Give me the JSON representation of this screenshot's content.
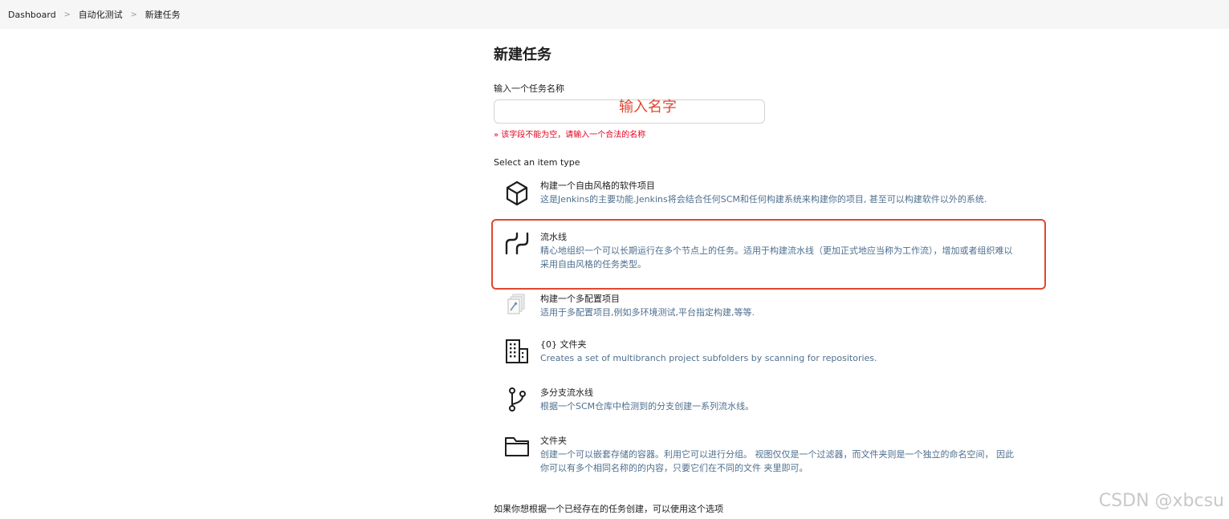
{
  "breadcrumb": {
    "items": [
      "Dashboard",
      "自动化测试",
      "新建任务"
    ],
    "separator": ">"
  },
  "page": {
    "title": "新建任务"
  },
  "name_field": {
    "label": "输入一个任务名称",
    "value": "",
    "annotation": "输入名字",
    "error": "» 该字段不能为空，请输入一个合法的名称"
  },
  "item_type": {
    "label": "Select an item type",
    "items": [
      {
        "icon": "box-icon",
        "name": "构建一个自由风格的软件项目",
        "desc_lines": [
          "这是Jenkins的主要功能.Jenkins将会结合任何SCM和任何构建系统来构建你的项目, 甚至可以构建软件以外的系统."
        ]
      },
      {
        "icon": "pipeline-icon",
        "name": "流水线",
        "desc_lines": [
          "精心地组织一个可以长期运行在多个节点上的任务。适用于构建流水线（更加正式地应当称为工作流），增加或者组织难以",
          "采用自由风格的任务类型。"
        ],
        "highlighted": true
      },
      {
        "icon": "multi-config-icon",
        "name": "构建一个多配置项目",
        "desc_lines": [
          "适用于多配置项目,例如多环境测试,平台指定构建,等等."
        ]
      },
      {
        "icon": "organization-folder-icon",
        "name": "{0} 文件夹",
        "desc_lines": [
          "Creates a set of multibranch project subfolders by scanning for repositories."
        ]
      },
      {
        "icon": "branch-icon",
        "name": "多分支流水线",
        "desc_lines": [
          "根据一个SCM仓库中检测到的分支创建一系列流水线。"
        ]
      },
      {
        "icon": "folder-icon",
        "name": "文件夹",
        "desc_lines": [
          "创建一个可以嵌套存储的容器。利用它可以进行分组。 视图仅仅是一个过滤器，而文件夹则是一个独立的命名空间， 因此",
          "你可以有多个相同名称的的内容，只要它们在不同的文件 夹里即可。"
        ]
      }
    ]
  },
  "copy_from": {
    "label": "如果你想根据一个已经存在的任务创建，可以使用这个选项"
  },
  "watermark": "CSDN @xbcsu",
  "colors": {
    "highlight": "#e0472f",
    "error": "#e6001f",
    "description": "#4f6f8f",
    "topbar": "#f6f6f7"
  }
}
